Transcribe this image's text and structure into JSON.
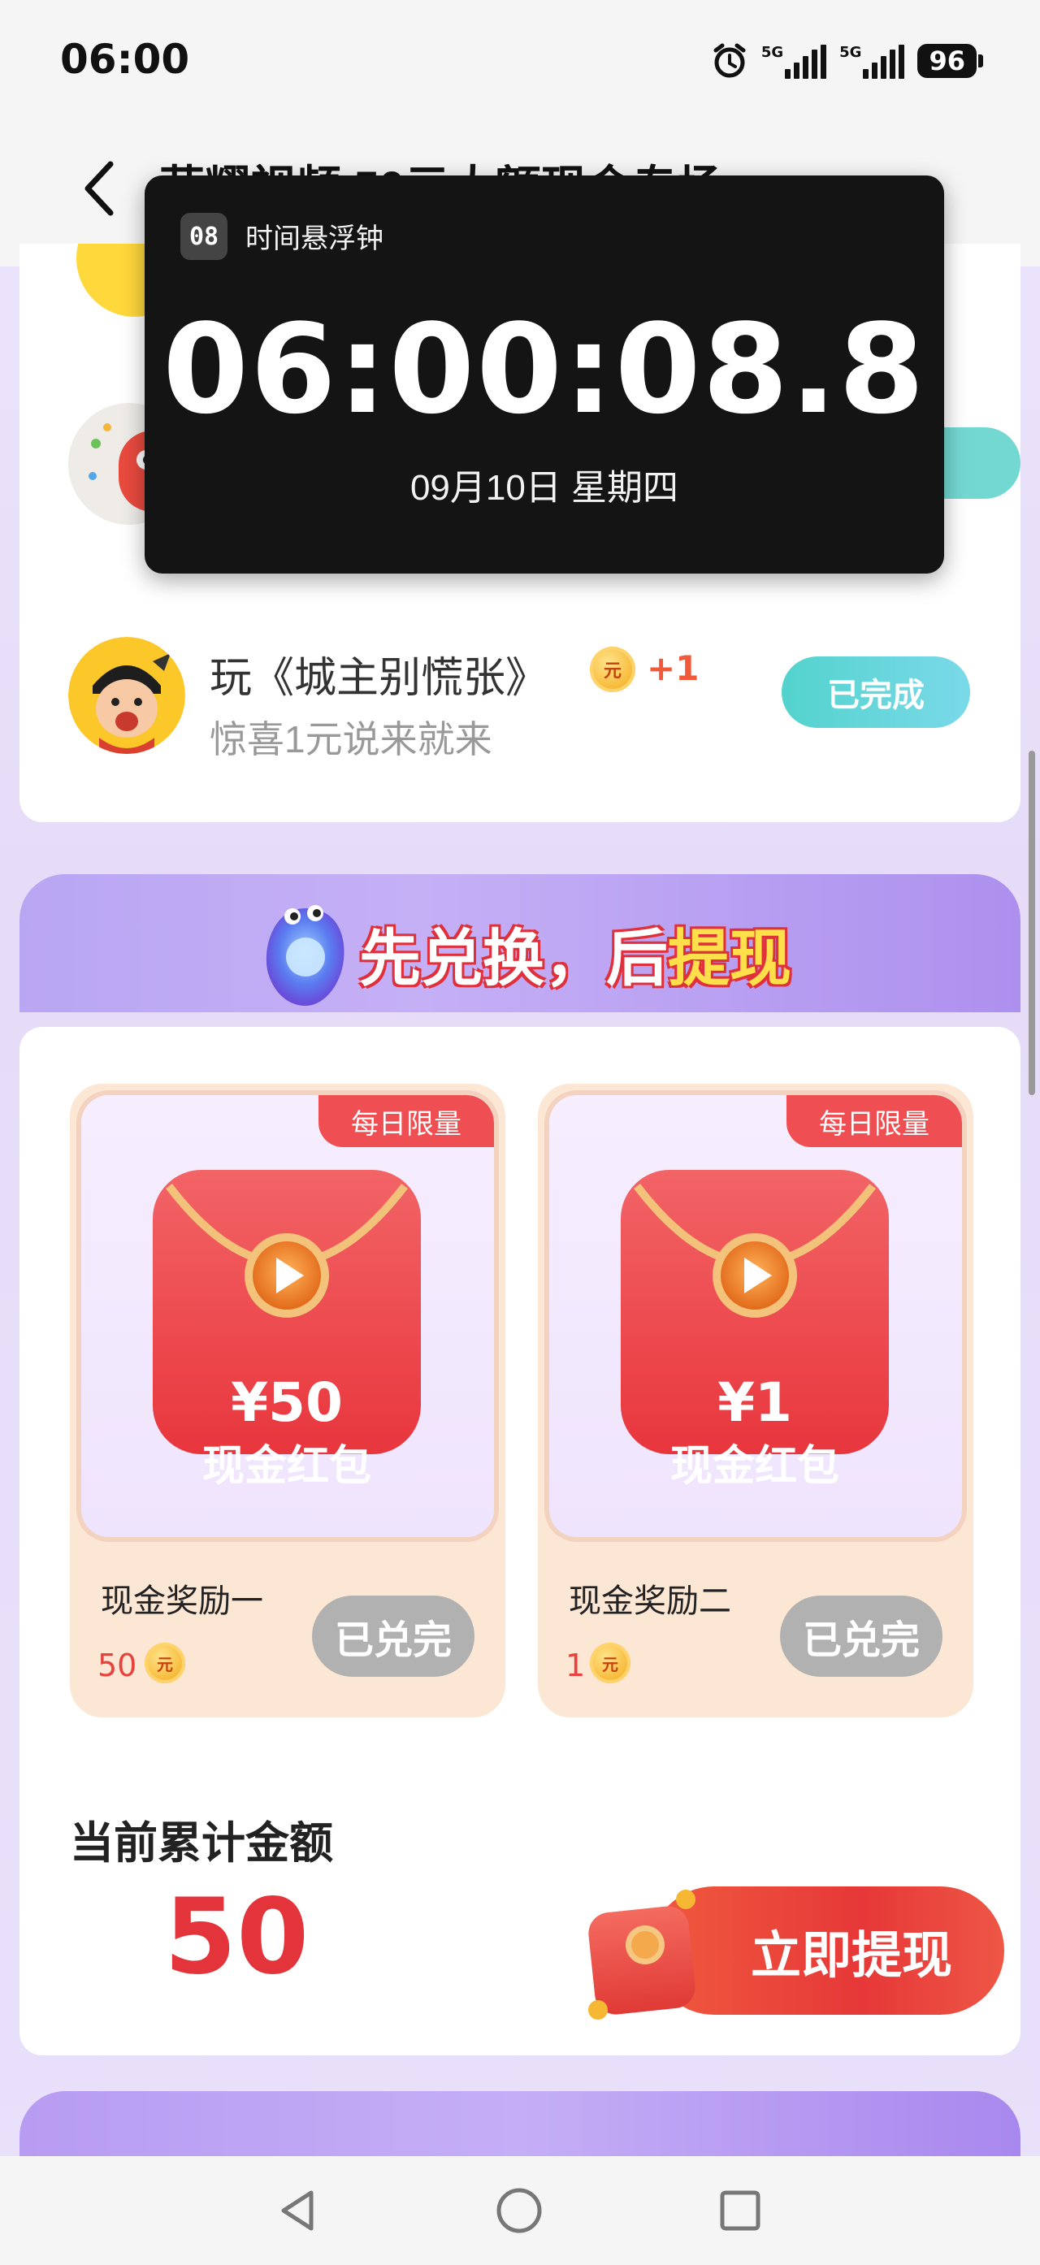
{
  "status_bar": {
    "time": "06:00",
    "net1": "5G",
    "net2": "5G",
    "battery": "96"
  },
  "header": {
    "title": "荣耀视频 50元大额现金专场"
  },
  "floating_clock": {
    "app_icon_text": "08",
    "app_name": "时间悬浮钟",
    "time": "06:00:08.8",
    "date": "09月10日 星期四"
  },
  "tasks": [
    {
      "title": "玩《城主别慌张》",
      "subtitle": "惊喜1元说来就来",
      "reward": "+1",
      "coin_label": "元",
      "button": "已完成"
    }
  ],
  "exchange": {
    "banner_prefix": "先兑换，后",
    "banner_highlight": "提现",
    "items": [
      {
        "tag": "每日限量",
        "amount": "¥50",
        "label": "现金红包",
        "name": "现金奖励一",
        "value": "50",
        "coin_label": "元",
        "button": "已兑完"
      },
      {
        "tag": "每日限量",
        "amount": "¥1",
        "label": "现金红包",
        "name": "现金奖励二",
        "value": "1",
        "coin_label": "元",
        "button": "已兑完"
      }
    ],
    "total_label": "当前累计金额",
    "total_amount": "50",
    "withdraw_button": "立即提现"
  },
  "colors": {
    "accent_red": "#e3343b",
    "done_teal": "#53d3cd",
    "banner_purple": "#b9a6f3",
    "redeemed_gray": "#b1b1b1"
  }
}
